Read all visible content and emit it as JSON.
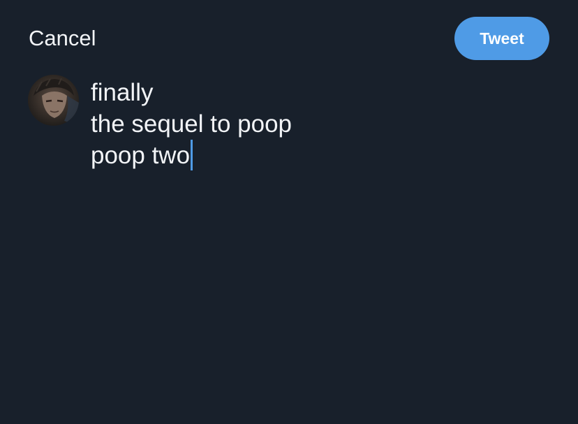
{
  "header": {
    "cancel_label": "Cancel",
    "tweet_label": "Tweet"
  },
  "compose": {
    "lines": [
      "finally",
      "the sequel to poop",
      "poop two"
    ]
  },
  "colors": {
    "background": "#18202b",
    "accent": "#4f9be6",
    "text": "#f2f4f7"
  },
  "icons": {
    "avatar": "user-avatar"
  }
}
